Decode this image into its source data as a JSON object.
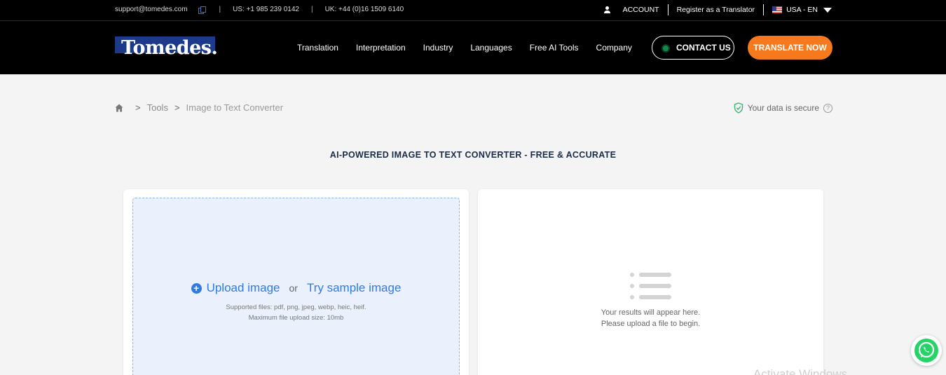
{
  "topbar": {
    "email": "support@tomedes.com",
    "separator": "|",
    "phone_us": "US: +1 985 239 0142",
    "phone_uk": "UK: +44 (0)16 1509 6140",
    "account_label": "ACCOUNT",
    "register_label": "Register as a Translator",
    "locale_label": "USA - EN"
  },
  "header": {
    "logo_text": "Tomedes.",
    "nav": [
      "Translation",
      "Interpretation",
      "Industry",
      "Languages",
      "Free AI Tools",
      "Company"
    ],
    "contact_label": "CONTACT US",
    "translate_label": "TRANSLATE NOW"
  },
  "breadcrumb": {
    "chevron": ">",
    "tools": "Tools",
    "current": "Image to Text Converter"
  },
  "secure": {
    "label": "Your data is secure",
    "help": "?"
  },
  "page_title": "AI-POWERED IMAGE TO TEXT CONVERTER - FREE & ACCURATE",
  "upload": {
    "plus": "+",
    "upload_label": "Upload image",
    "or": "or",
    "sample_label": "Try sample image",
    "supported": "Supported files: pdf, png, jpeg, webp, heic, heif.",
    "max_size": "Maximum file upload size: 10mb"
  },
  "results": {
    "line1": "Your results will appear here.",
    "line2": "Please upload a file to begin."
  },
  "watermark": "Activate Windows",
  "colors": {
    "accent_blue": "#2f7ae5",
    "orange": "#f7791d",
    "secure_green": "#3cb371",
    "whatsapp": "#25d366"
  },
  "icons": [
    "copy-icon",
    "user-icon",
    "us-flag-icon",
    "chevron-down-icon",
    "home-icon",
    "shield-check-icon",
    "help-icon",
    "plus-circle-icon",
    "list-icon",
    "whatsapp-icon"
  ]
}
